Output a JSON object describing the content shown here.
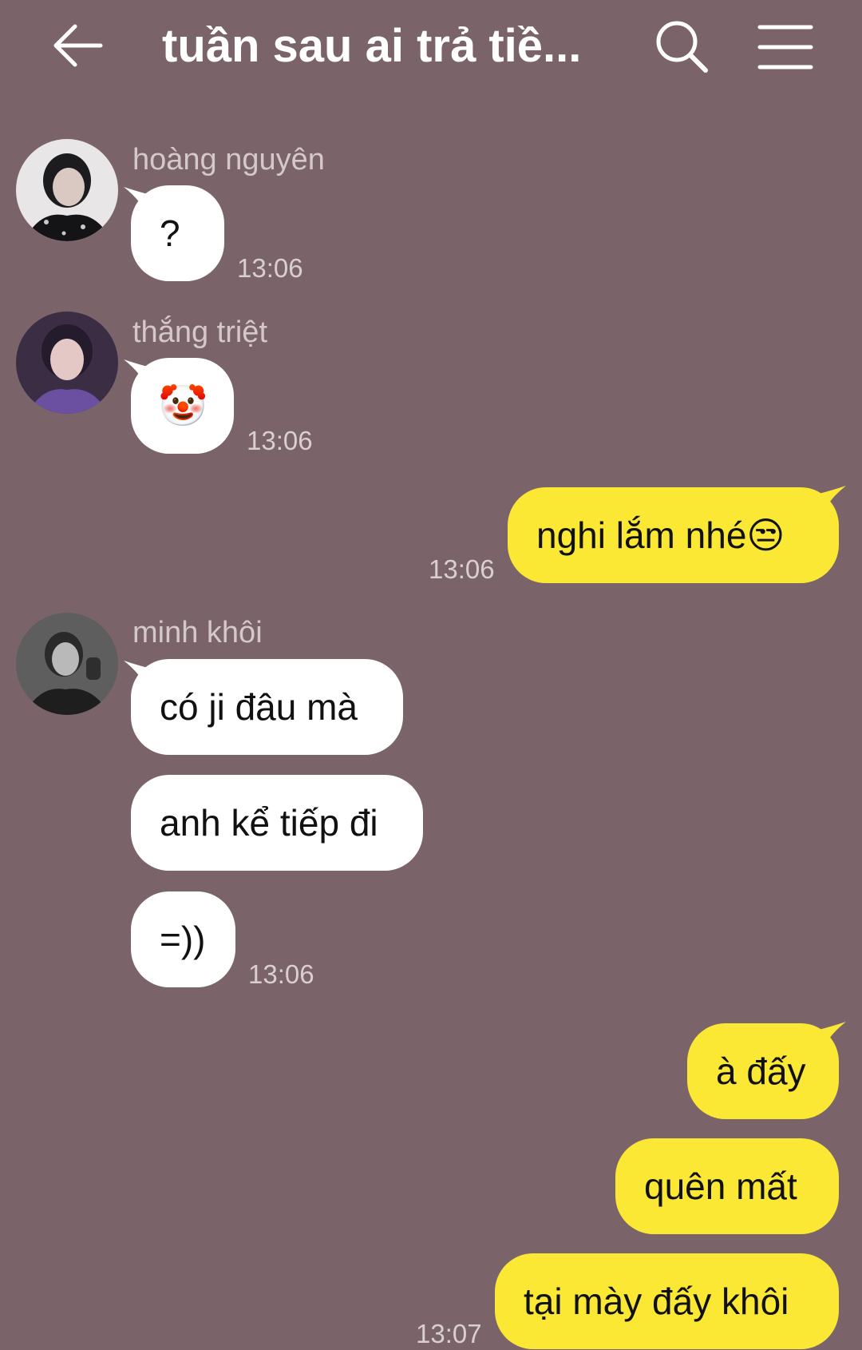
{
  "header": {
    "title": "tuần sau ai trả tiề..."
  },
  "messages": [
    {
      "sender": "hoàng nguyên",
      "text": "?",
      "time": "13:06"
    },
    {
      "sender": "thắng triệt",
      "text": "🤡",
      "time": "13:06"
    },
    {
      "text": "nghi lắm nhé😒",
      "time": "13:06"
    },
    {
      "sender": "minh khôi",
      "lines": [
        "có ji đâu mà",
        "anh kể tiếp đi",
        "=))"
      ],
      "time": "13:06"
    },
    {
      "lines": [
        "à đấy",
        "quên mất",
        "tại mày đấy khôi"
      ],
      "time": "13:07"
    }
  ],
  "colors": {
    "background": "#7b6469",
    "my_bubble": "#fbe834",
    "their_bubble": "#ffffff"
  }
}
